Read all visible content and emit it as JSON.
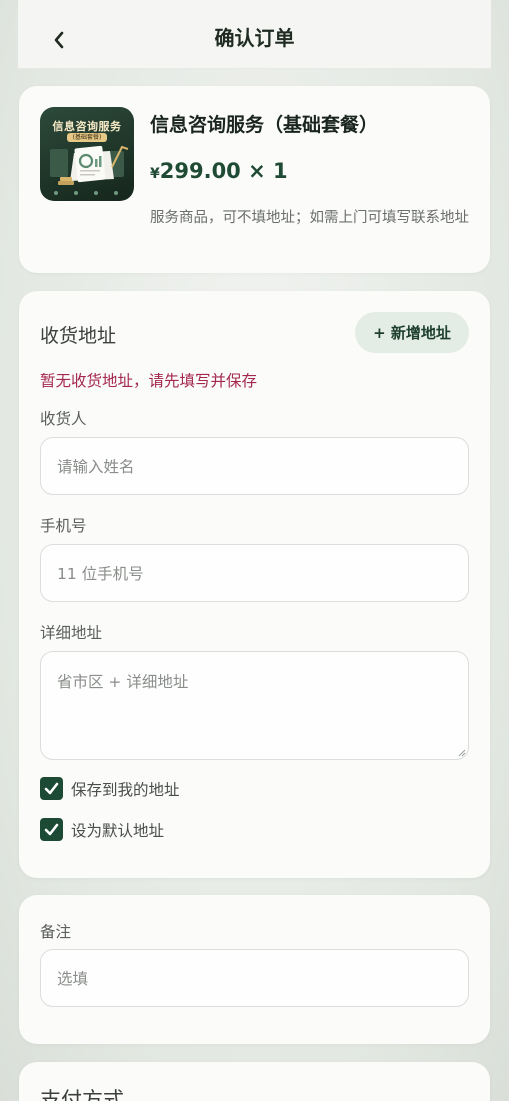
{
  "header": {
    "title": "确认订单",
    "back_icon": "chevron-left-icon"
  },
  "product": {
    "image_title": "信息咨询服务",
    "image_tag": "(基础套餐)",
    "name": "信息咨询服务（基础套餐）",
    "currency": "¥",
    "price": "299.00 × 1",
    "note": "服务商品，可不填地址；如需上门可填写联系地址"
  },
  "address": {
    "title": "收货地址",
    "add_button": "+ 新增地址",
    "warning": "暂无收货地址，请先填写并保存",
    "warning_color": "#a4284e",
    "receiver_label": "收货人",
    "receiver_placeholder": "请输入姓名",
    "phone_label": "手机号",
    "phone_placeholder": "11 位手机号",
    "detail_label": "详细地址",
    "detail_placeholder": "省市区 + 详细地址",
    "save_to_my_address": "保存到我的地址",
    "save_checked": true,
    "set_default": "设为默认地址",
    "default_checked": true
  },
  "remark": {
    "label": "备注",
    "placeholder": "选填"
  },
  "payment": {
    "title": "支付方式"
  },
  "colors": {
    "accent": "#1d4a35",
    "price": "#1f4a33"
  }
}
